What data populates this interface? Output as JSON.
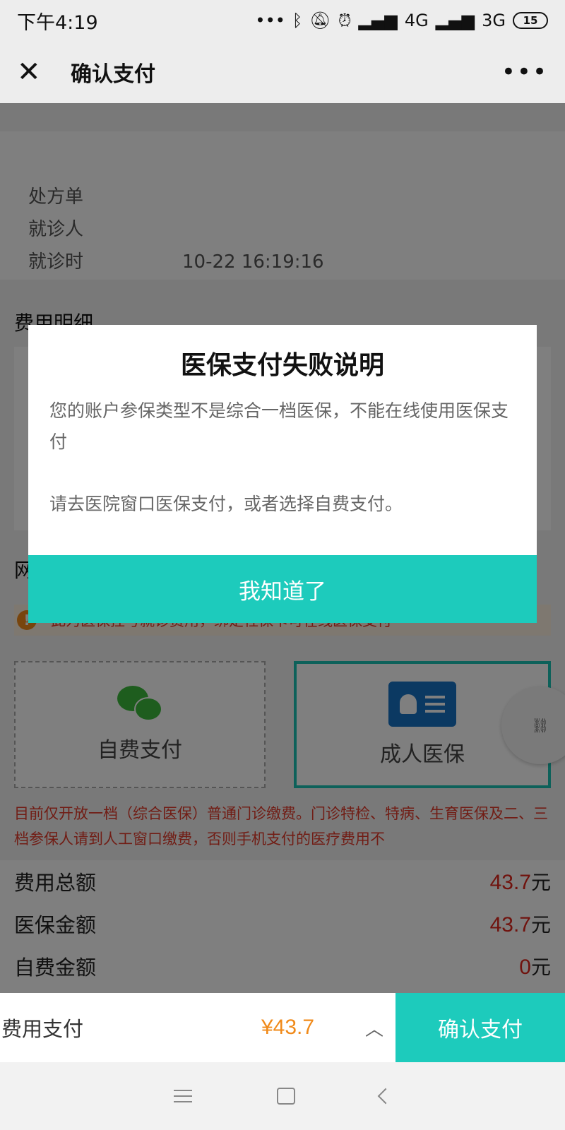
{
  "status_bar": {
    "time": "下午4:19",
    "network_1": "4G",
    "network_2": "3G",
    "battery": "15"
  },
  "header": {
    "title": "确认支付"
  },
  "background": {
    "info_lines": [
      "处方单",
      "就诊人",
      "就诊时"
    ],
    "info_time": "10-22 16:19:16",
    "fee_section_title": "费用明细",
    "pay_section_title": "网",
    "notice_text": "此为医保挂号就诊费用，绑定社保卡可在线医保支付",
    "option_self_pay": "自费支付",
    "option_medical": "成人医保",
    "note_text": "目前仅开放一档（综合医保）普通门诊缴费。门诊特检、特病、生育医保及二、三档参保人请到人工窗口缴费，否则手机支付的医疗费用不"
  },
  "summary": {
    "rows": [
      {
        "label": "费用总额",
        "value": "43.7",
        "unit": "元"
      },
      {
        "label": "医保金额",
        "value": "43.7",
        "unit": "元"
      },
      {
        "label": "自费金额",
        "value": "0",
        "unit": "元"
      }
    ]
  },
  "modal": {
    "title": "医保支付失败说明",
    "paragraph_1": "您的账户参保类型不是综合一档医保，不能在线使用医保支付",
    "paragraph_2": "请去医院窗口医保支付，或者选择自费支付。",
    "button": "我知道了"
  },
  "pay_bar": {
    "label": "费用支付",
    "amount": "¥43.7",
    "confirm": "确认支付"
  },
  "colors": {
    "accent": "#1dcbbc",
    "warning": "#e0261c",
    "amount": "#f08a1a"
  }
}
